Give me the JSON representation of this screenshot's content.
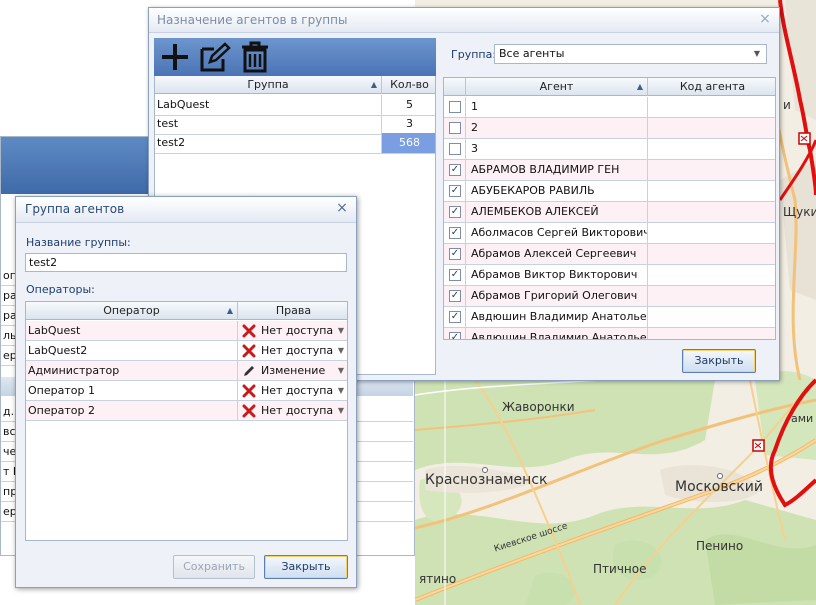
{
  "map": {
    "labels": [
      "Жаворонки",
      "Краснознаменск",
      "Московский",
      "Пенино",
      "Птичное",
      "Киевское шоссе",
      "ятино",
      "Щукин",
      "и",
      "ами"
    ]
  },
  "background_window": {
    "rows": [
      "огр",
      "рад",
      "рад",
      "льн",
      "ере",
      "д. 1",
      "вск",
      "чер",
      "т В",
      "про",
      "ере"
    ]
  },
  "assign_dialog": {
    "title": "Назначение агентов в группы",
    "close_glyph": "×",
    "toolbar": {
      "add_icon": "plus-icon",
      "edit_icon": "edit-icon",
      "delete_icon": "trash-icon"
    },
    "groups_table": {
      "columns": [
        "Группа",
        "Кол-во"
      ],
      "sort_glyph": "▲",
      "rows": [
        {
          "name": "LabQuest",
          "count": "5"
        },
        {
          "name": "test",
          "count": "3"
        },
        {
          "name": "test2",
          "count": "568"
        }
      ]
    },
    "group_filter_label": "Группа:",
    "group_filter_value": "Все агенты",
    "agents_table": {
      "columns": [
        "Агент",
        "Код агента"
      ],
      "rows": [
        {
          "name": "1",
          "checked": false,
          "code": ""
        },
        {
          "name": "2",
          "checked": false,
          "code": ""
        },
        {
          "name": "3",
          "checked": false,
          "code": ""
        },
        {
          "name": "АБРАМОВ ВЛАДИМИР ГЕН",
          "checked": true,
          "code": ""
        },
        {
          "name": "АБУБЕКАРОВ РАВИЛЬ",
          "checked": true,
          "code": ""
        },
        {
          "name": "АЛЕМБЕКОВ АЛЕКСЕЙ",
          "checked": true,
          "code": ""
        },
        {
          "name": "Аболмасов Сергей Викторович",
          "checked": true,
          "code": ""
        },
        {
          "name": "Абрамов Алексей Сергеевич",
          "checked": true,
          "code": ""
        },
        {
          "name": "Абрамов Виктор Викторович",
          "checked": true,
          "code": ""
        },
        {
          "name": "Абрамов Григорий Олегович",
          "checked": true,
          "code": ""
        },
        {
          "name": "Авдюшин Владимир Анатольевич",
          "checked": true,
          "code": ""
        },
        {
          "name": "Авдюшин Владимир Анатольевич",
          "checked": true,
          "code": ""
        }
      ]
    },
    "close_button": "Закрыть"
  },
  "group_dialog": {
    "title": "Группа агентов",
    "close_glyph": "×",
    "name_label": "Название группы:",
    "name_value": "test2",
    "operators_label": "Операторы:",
    "operators_table": {
      "columns": [
        "Оператор",
        "Права"
      ],
      "sort_glyph": "▲",
      "rows": [
        {
          "operator": "LabQuest",
          "rights": "Нет доступа",
          "icon": "x-icon"
        },
        {
          "operator": "LabQuest2",
          "rights": "Нет доступа",
          "icon": "x-icon"
        },
        {
          "operator": "Администратор",
          "rights": "Изменение",
          "icon": "pencil-icon"
        },
        {
          "operator": "Оператор 1",
          "rights": "Нет доступа",
          "icon": "x-icon"
        },
        {
          "operator": "Оператор 2",
          "rights": "Нет доступа",
          "icon": "x-icon"
        }
      ]
    },
    "save_button": "Сохранить",
    "close_button": "Закрыть"
  },
  "colors": {
    "accent": "#4a74b5",
    "selection": "#7a9ee0",
    "route": "#e01010"
  }
}
